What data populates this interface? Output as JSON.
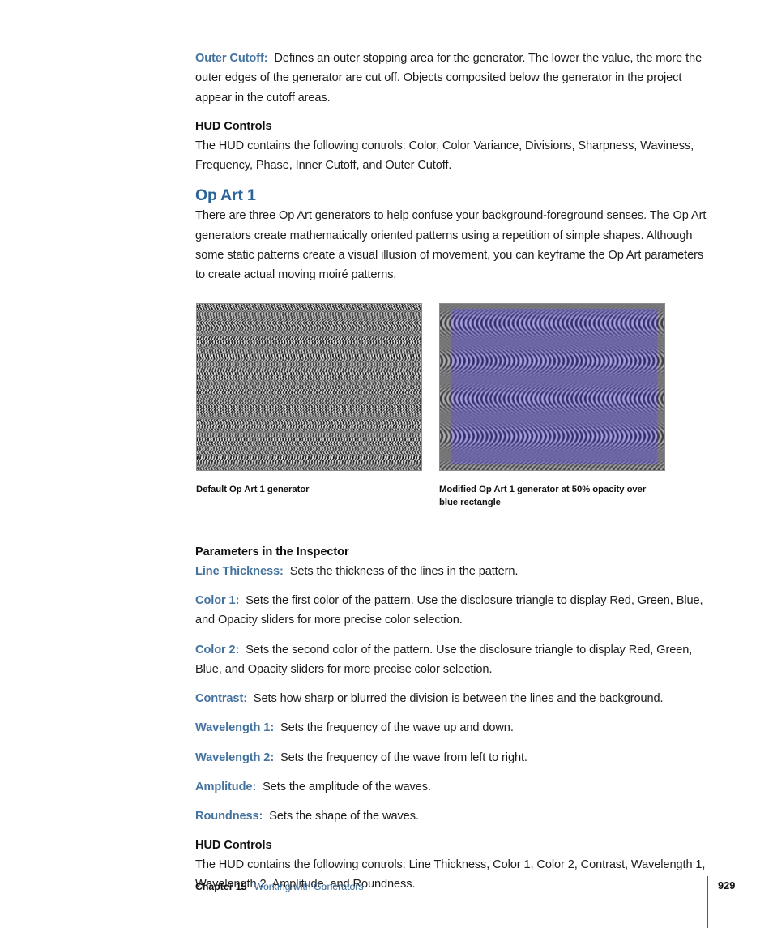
{
  "document": {
    "intro": {
      "outer_cutoff": {
        "term": "Outer Cutoff:",
        "description": "Defines an outer stopping area for the generator. The lower the value, the more the outer edges of the generator are cut off. Objects composited below the generator in the project appear in the cutoff areas."
      },
      "hud_controls_heading": "HUD Controls",
      "hud_controls_text": "The HUD contains the following controls: Color, Color Variance, Divisions, Sharpness, Waviness, Frequency, Phase, Inner Cutoff, and Outer Cutoff."
    },
    "section": {
      "title": "Op Art 1",
      "body": "There are three Op Art generators to help confuse your background-foreground senses. The Op Art generators create mathematically oriented patterns using a repetition of simple shapes. Although some static patterns create a visual illusion of movement, you can keyframe the Op Art parameters to create actual moving moiré patterns."
    },
    "figures": {
      "left": {
        "caption": "Default Op Art 1 generator",
        "pattern": "grayscale-wavy-vertical-lines",
        "colors": {
          "light": "#ffffff",
          "dark": "#1a1a1a",
          "border": "#8b8b8b"
        }
      },
      "right": {
        "caption": "Modified Op Art 1 generator at 50% opacity over blue rectangle",
        "pattern": "blue-arc-bands",
        "colors": {
          "blue": "#5a4ecb",
          "light_blue": "#9b94e2",
          "dark": "#211f3a",
          "gray": "#6d6d74",
          "border": "#8b8b8b"
        }
      }
    },
    "parameters": {
      "heading": "Parameters in the Inspector",
      "items": [
        {
          "term": "Line Thickness:",
          "description": "Sets the thickness of the lines in the pattern."
        },
        {
          "term": "Color 1:",
          "description": "Sets the first color of the pattern. Use the disclosure triangle to display Red, Green, Blue, and Opacity sliders for more precise color selection."
        },
        {
          "term": "Color 2:",
          "description": "Sets the second color of the pattern. Use the disclosure triangle to display Red, Green, Blue, and Opacity sliders for more precise color selection."
        },
        {
          "term": "Contrast:",
          "description": "Sets how sharp or blurred the division is between the lines and the background."
        },
        {
          "term": "Wavelength 1:",
          "description": "Sets the frequency of the wave up and down."
        },
        {
          "term": "Wavelength 2:",
          "description": "Sets the frequency of the wave from left to right."
        },
        {
          "term": "Amplitude:",
          "description": "Sets the amplitude of the waves."
        },
        {
          "term": "Roundness:",
          "description": "Sets the shape of the waves."
        }
      ]
    },
    "hud": {
      "heading": "HUD Controls",
      "text": "The HUD contains the following controls: Line Thickness, Color 1, Color 2, Contrast, Wavelength 1, Wavelength 2, Amplitude, and Roundness."
    },
    "footer": {
      "chapter": "Chapter 15",
      "chapter_title": "Working with Generators",
      "page_number": "929",
      "rule_color": "#2a6397"
    }
  }
}
